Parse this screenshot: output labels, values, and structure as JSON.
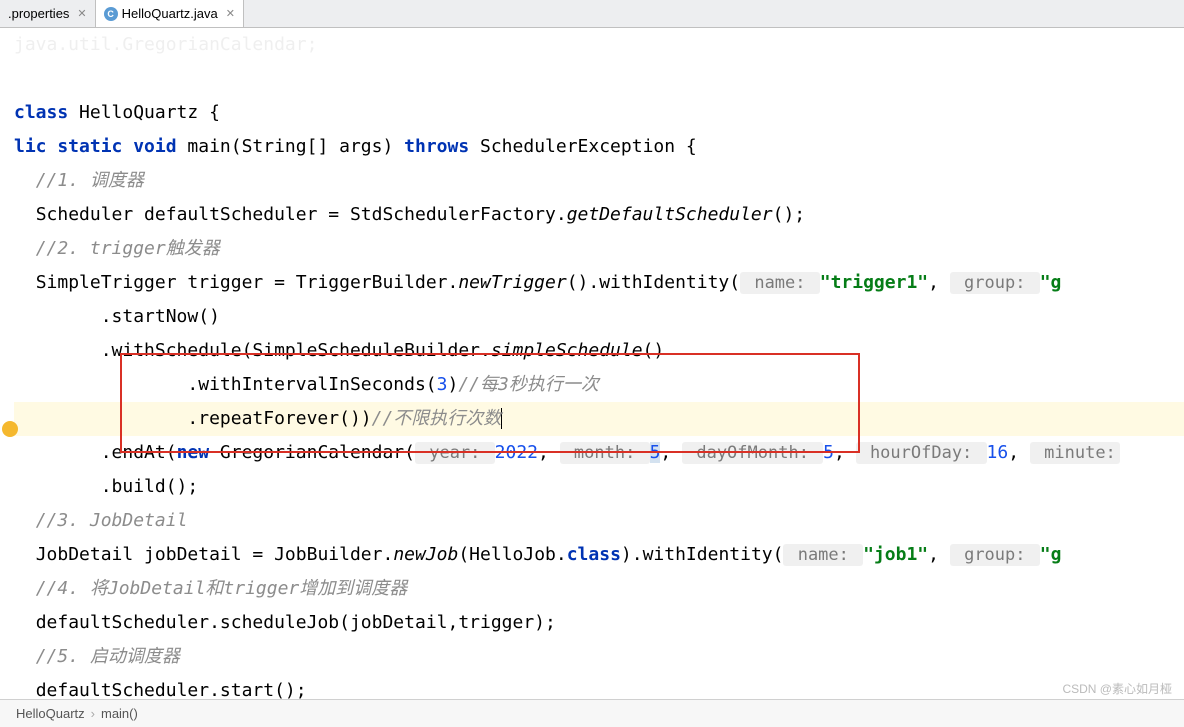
{
  "tabs": {
    "tab1": {
      "label": ".properties"
    },
    "tab2": {
      "label": "HelloQuartz.java",
      "iconLetter": "C"
    }
  },
  "code": {
    "line0": "java.util.GregorianCalendar;",
    "classDecl": {
      "prefix": "class",
      "name": " HelloQuartz {"
    },
    "mainDecl": {
      "modifiers": "lic static void",
      "sig": " main(String[] args) ",
      "throws": "throws",
      "exc": " SchedulerException {"
    },
    "c1": "//1. 调度器",
    "l1_a": "Scheduler defaultScheduler = StdSchedulerFactory.",
    "l1_b": "getDefaultScheduler",
    "l1_c": "();",
    "c2": "//2. trigger触发器",
    "l2_a": "SimpleTrigger trigger = TriggerBuilder.",
    "l2_b": "newTrigger",
    "l2_c": "().withIdentity(",
    "h_name": " name: ",
    "s_trigger1": "\"trigger1\"",
    "comma": ", ",
    "h_group": " group: ",
    "l2_end": "\"g",
    "l3": "        .startNow()",
    "l4_a": "        .withSchedule(SimpleScheduleBuilder.",
    "l4_b": "simpleSchedule",
    "l4_c": "()",
    "l5_a": "                .withIntervalInSeconds(",
    "l5_n": "3",
    "l5_b": ")",
    "l5_c": "//每3秒执行一次",
    "l6_a": "                .repeatForever())",
    "l6_c": "//不限执行次数",
    "l7_a": "        .endAt(",
    "l7_new": "new",
    "l7_b": " GregorianCalendar(",
    "h_year": " year: ",
    "n_year": "2022",
    "h_month": " month: ",
    "n_month": "5",
    "h_day": " dayOfMonth: ",
    "n_day": "5",
    "h_hour": " hourOfDay: ",
    "n_hour": "16",
    "h_min": " minute:",
    "l8": "        .build();",
    "c3": "//3. JobDetail",
    "l9_a": "JobDetail jobDetail = JobBuilder.",
    "l9_b": "newJob",
    "l9_c": "(HelloJob.",
    "l9_d": "class",
    "l9_e": ").withIdentity(",
    "s_job1": "\"job1\"",
    "c4": "//4. 将JobDetail和trigger增加到调度器",
    "l10": "defaultScheduler.scheduleJob(jobDetail,trigger);",
    "c5": "//5. 启动调度器",
    "l11": "defaultScheduler.start();"
  },
  "breadcrumb": {
    "item1": "HelloQuartz",
    "item2": "main()"
  },
  "watermark": "CSDN @素心如月桠"
}
